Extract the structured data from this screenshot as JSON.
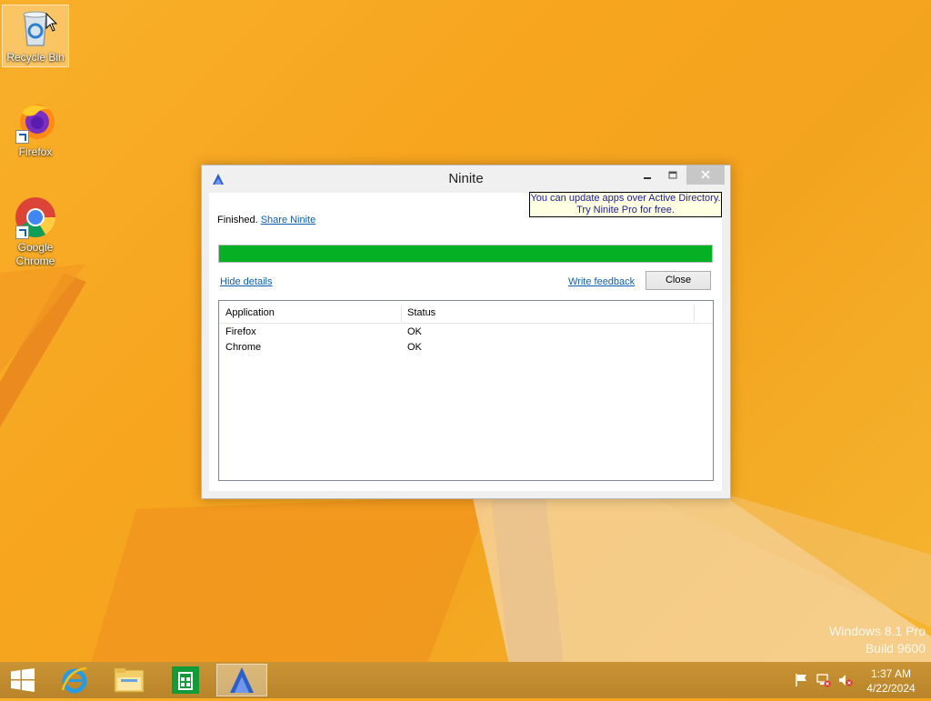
{
  "desktop": {
    "icons": [
      {
        "label": "Recycle Bin"
      },
      {
        "label": "Firefox"
      },
      {
        "label": "Google Chrome"
      }
    ]
  },
  "window": {
    "title": "Ninite",
    "status_prefix": "Finished.",
    "share_link": "Share Ninite",
    "promo_line1": "You can update apps over Active Directory.",
    "promo_line2": "Try Ninite Pro for free.",
    "progress_percent": 100,
    "hide_details": "Hide details",
    "write_feedback": "Write feedback",
    "close_button": "Close",
    "table": {
      "columns": [
        "Application",
        "Status"
      ],
      "rows": [
        [
          "Firefox",
          "OK"
        ],
        [
          "Chrome",
          "OK"
        ]
      ]
    }
  },
  "watermark": {
    "line1": "Windows 8.1 Pro",
    "line2": "Build 9600"
  },
  "taskbar": {
    "items": [
      "start",
      "internet-explorer",
      "file-explorer",
      "store",
      "ninite"
    ],
    "clock_time": "1:37 AM",
    "clock_date": "4/22/2024"
  },
  "colors": {
    "progress": "#06b025",
    "link": "#0b5eb5",
    "wallpaper": "#f7a51f"
  }
}
